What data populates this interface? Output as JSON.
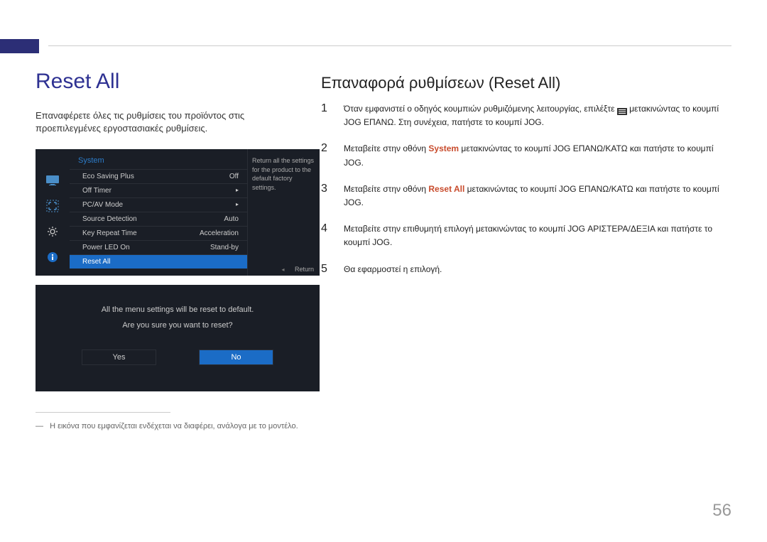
{
  "page_header": {
    "title": "Reset All",
    "intro": "Επαναφέρετε όλες τις ρυθμίσεις του προϊόντος στις προεπιλεγμένες εργοστασιακές ρυθμίσεις."
  },
  "osd": {
    "section": "System",
    "items": [
      {
        "label": "Eco Saving Plus",
        "value": "Off"
      },
      {
        "label": "Off Timer",
        "value": "▸"
      },
      {
        "label": "PC/AV Mode",
        "value": "▸"
      },
      {
        "label": "Source Detection",
        "value": "Auto"
      },
      {
        "label": "Key Repeat Time",
        "value": "Acceleration"
      },
      {
        "label": "Power LED On",
        "value": "Stand-by"
      },
      {
        "label": "Reset All",
        "value": ""
      }
    ],
    "help": "Return all the settings for the product to the default factory settings.",
    "return": "Return"
  },
  "confirm": {
    "msg1": "All the menu settings will be reset to default.",
    "msg2": "Are you sure you want to reset?",
    "yes": "Yes",
    "no": "No"
  },
  "footnote": "Η εικόνα που εμφανίζεται ενδέχεται να διαφέρει, ανάλογα με το μοντέλο.",
  "right_section": {
    "title": "Επαναφορά ρυθμίσεων (Reset All)",
    "steps": {
      "1": {
        "pre": "Όταν εμφανιστεί ο οδηγός κουμπιών ρυθμιζόμενης λειτουργίας, επιλέξτε ",
        "post": " μετακινώντας το κουμπί JOG ΕΠΑΝΩ. Στη συνέχεια, πατήστε το κουμπί JOG."
      },
      "2": {
        "pre": "Μεταβείτε στην οθόνη ",
        "hl": "System",
        "post": " μετακινώντας το κουμπί JOG ΕΠΑΝΩ/ΚΑΤΩ και πατήστε το κουμπί JOG."
      },
      "3": {
        "pre": "Μεταβείτε στην οθόνη ",
        "hl": "Reset All",
        "post": " μετακινώντας το κουμπί JOG ΕΠΑΝΩ/ΚΑΤΩ και πατήστε το κουμπί JOG."
      },
      "4": {
        "text": "Μεταβείτε στην επιθυμητή επιλογή μετακινώντας το κουμπί JOG ΑΡΙΣΤΕΡΑ/ΔΕΞΙΑ και πατήστε το κουμπί JOG."
      },
      "5": {
        "text": "Θα εφαρμοστεί η επιλογή."
      }
    }
  },
  "page_number": "56"
}
